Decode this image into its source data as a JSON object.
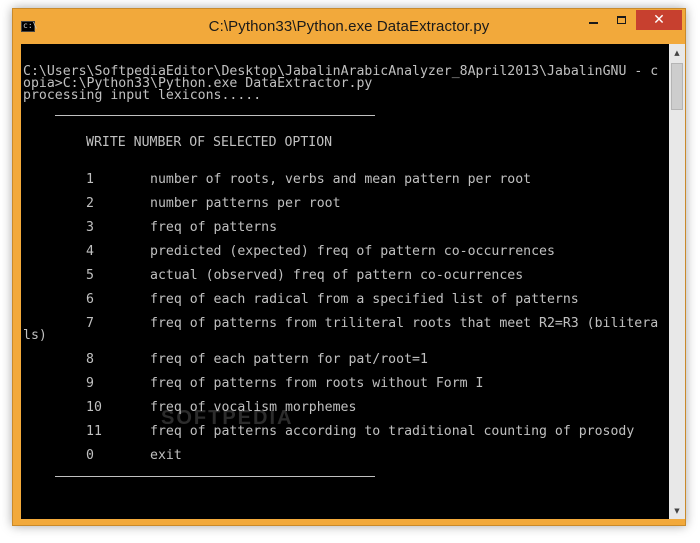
{
  "window": {
    "title": "C:\\Python33\\Python.exe  DataExtractor.py",
    "icon": "console-icon",
    "buttons": {
      "minimize": "minimize-icon",
      "maximize": "maximize-icon",
      "close": "✕"
    },
    "colors": {
      "frame": "#f2a93b",
      "close": "#c7402f",
      "console_bg": "#000000",
      "console_text": "#c0c0c0"
    }
  },
  "console": {
    "line1": "C:\\Users\\SoftpediaEditor\\Desktop\\JabalinArabicAnalyzer_8April2013\\JabalinGNU - c",
    "line2": "opia>C:\\Python33\\Python.exe DataExtractor.py",
    "line3": "processing input lexicons.....",
    "heading": "WRITE NUMBER OF SELECTED OPTION",
    "options": [
      {
        "num": "1",
        "label": "number of roots, verbs and mean pattern per root"
      },
      {
        "num": "2",
        "label": "number patterns per root"
      },
      {
        "num": "3",
        "label": "freq of patterns"
      },
      {
        "num": "4",
        "label": "predicted (expected) freq of pattern co-occurrences"
      },
      {
        "num": "5",
        "label": "actual (observed) freq of pattern co-ocurrences"
      },
      {
        "num": "6",
        "label": "freq of each radical from a specified list of patterns"
      },
      {
        "num": "7",
        "label": "freq of patterns from triliteral roots that meet R2=R3 (bilitera",
        "wrap": "ls)"
      },
      {
        "num": "8",
        "label": "freq of each pattern for pat/root=1"
      },
      {
        "num": "9",
        "label": "freq of patterns from roots without Form I"
      },
      {
        "num": "10",
        "label": "freq of vocalism morphemes"
      },
      {
        "num": "11",
        "label": "freq of patterns according to traditional counting of prosody"
      },
      {
        "num": "0",
        "label": "exit"
      }
    ]
  },
  "watermark": "SOFTPEDIA"
}
